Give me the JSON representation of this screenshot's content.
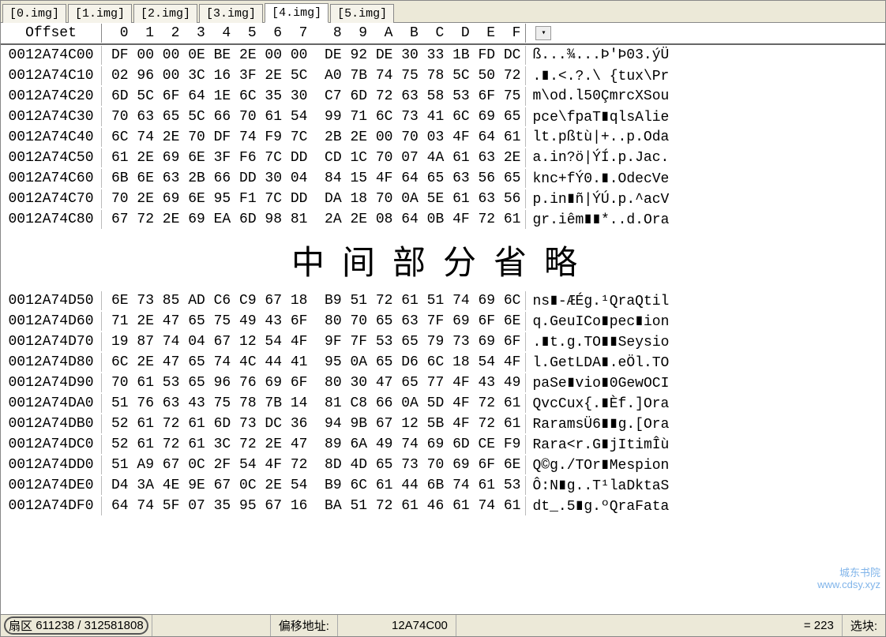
{
  "tabs": [
    {
      "label": "[0.img]"
    },
    {
      "label": "[1.img]"
    },
    {
      "label": "[2.img]"
    },
    {
      "label": "[3.img]"
    },
    {
      "label": "[4.img]"
    },
    {
      "label": "[5.img]"
    }
  ],
  "active_tab_index": 4,
  "header": {
    "offset_label": "Offset",
    "hex_cols": " 0  1  2  3  4  5  6  7   8  9  A  B  C  D  E  F",
    "dropdown_glyph": "▾"
  },
  "rows_top": [
    {
      "off": "0012A74C00",
      "hex": "DF 00 00 0E BE 2E 00 00  DE 92 DE 30 33 1B FD DC",
      "asc": "ß...¾...Þ'Þ03.ýÜ"
    },
    {
      "off": "0012A74C10",
      "hex": "02 96 00 3C 16 3F 2E 5C  A0 7B 74 75 78 5C 50 72",
      "asc": ".∎.<.?.\\ {tux\\Pr"
    },
    {
      "off": "0012A74C20",
      "hex": "6D 5C 6F 64 1E 6C 35 30  C7 6D 72 63 58 53 6F 75",
      "asc": "m\\od.l50ÇmrcXSou"
    },
    {
      "off": "0012A74C30",
      "hex": "70 63 65 5C 66 70 61 54  99 71 6C 73 41 6C 69 65",
      "asc": "pce\\fpaT∎qlsAlie"
    },
    {
      "off": "0012A74C40",
      "hex": "6C 74 2E 70 DF 74 F9 7C  2B 2E 00 70 03 4F 64 61",
      "asc": "lt.pßtù|+..p.Oda"
    },
    {
      "off": "0012A74C50",
      "hex": "61 2E 69 6E 3F F6 7C DD  CD 1C 70 07 4A 61 63 2E",
      "asc": "a.in?ö|ÝÍ.p.Jac."
    },
    {
      "off": "0012A74C60",
      "hex": "6B 6E 63 2B 66 DD 30 04  84 15 4F 64 65 63 56 65",
      "asc": "knc+fÝ0.∎.OdecVe"
    },
    {
      "off": "0012A74C70",
      "hex": "70 2E 69 6E 95 F1 7C DD  DA 18 70 0A 5E 61 63 56",
      "asc": "p.in∎ñ|ÝÚ.p.^acV"
    },
    {
      "off": "0012A74C80",
      "hex": "67 72 2E 69 EA 6D 98 81  2A 2E 08 64 0B 4F 72 61",
      "asc": "gr.iêm∎∎*..d.Ora"
    }
  ],
  "ellipsis_text": "中间部分省略",
  "rows_bottom": [
    {
      "off": "0012A74D50",
      "hex": "6E 73 85 AD C6 C9 67 18  B9 51 72 61 51 74 69 6C",
      "asc": "ns∎-ÆÉg.¹QraQtil"
    },
    {
      "off": "0012A74D60",
      "hex": "71 2E 47 65 75 49 43 6F  80 70 65 63 7F 69 6F 6E",
      "asc": "q.GeuICo∎pec∎ion"
    },
    {
      "off": "0012A74D70",
      "hex": "19 87 74 04 67 12 54 4F  9F 7F 53 65 79 73 69 6F",
      "asc": ".∎t.g.TO∎∎Seysio"
    },
    {
      "off": "0012A74D80",
      "hex": "6C 2E 47 65 74 4C 44 41  95 0A 65 D6 6C 18 54 4F",
      "asc": "l.GetLDA∎.eÖl.TO"
    },
    {
      "off": "0012A74D90",
      "hex": "70 61 53 65 96 76 69 6F  80 30 47 65 77 4F 43 49",
      "asc": "paSe∎vio∎0GewOCI"
    },
    {
      "off": "0012A74DA0",
      "hex": "51 76 63 43 75 78 7B 14  81 C8 66 0A 5D 4F 72 61",
      "asc": "QvcCux{.∎Èf.]Ora"
    },
    {
      "off": "0012A74DB0",
      "hex": "52 61 72 61 6D 73 DC 36  94 9B 67 12 5B 4F 72 61",
      "asc": "RaramsÜ6∎∎g.[Ora"
    },
    {
      "off": "0012A74DC0",
      "hex": "52 61 72 61 3C 72 2E 47  89 6A 49 74 69 6D CE F9",
      "asc": "Rara<r.G∎jItimÎù"
    },
    {
      "off": "0012A74DD0",
      "hex": "51 A9 67 0C 2F 54 4F 72  8D 4D 65 73 70 69 6F 6E",
      "asc": "Q©g./TOr∎Mespion"
    },
    {
      "off": "0012A74DE0",
      "hex": "D4 3A 4E 9E 67 0C 2E 54  B9 6C 61 44 6B 74 61 53",
      "asc": "Ô:N∎g..T¹laDktaS"
    },
    {
      "off": "0012A74DF0",
      "hex": "64 74 5F 07 35 95 67 16  BA 51 72 61 46 61 74 61",
      "asc": "dt_.5∎g.ºQraFata"
    }
  ],
  "status": {
    "sector_label": "扇区",
    "sector_value": "611238 / 312581808",
    "offset_label": "偏移地址:",
    "offset_value": "12A74C00",
    "eq_value": "= 223",
    "selblock_label": "选块:"
  },
  "watermark": {
    "line1": "城东书院",
    "line2": "www.cdsy.xyz"
  }
}
